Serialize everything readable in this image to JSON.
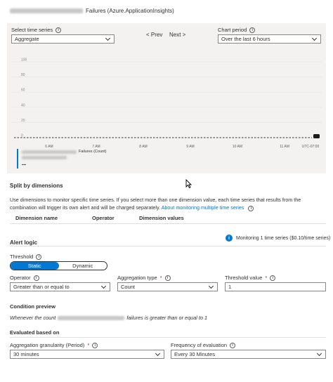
{
  "header": {
    "title_suffix": "Failures (Azure.ApplicationInsights)"
  },
  "timeseries": {
    "label": "Select time series",
    "value": "Aggregate",
    "prev_label": "< Prev",
    "next_label": "Next >"
  },
  "chart_period": {
    "label": "Chart period",
    "value": "Over the last 6 hours"
  },
  "chart_data": {
    "type": "line",
    "y_ticks": [
      "100",
      "80",
      "60",
      "40",
      "20",
      "0"
    ],
    "ylim": [
      0,
      100
    ],
    "x_ticks": [
      "6 AM",
      "7 AM",
      "8 AM",
      "9 AM",
      "10 AM",
      "11 AM",
      "UTC-07:00"
    ],
    "series": [
      {
        "name": "Failures (Count)",
        "values": [
          0,
          0,
          0,
          0,
          0,
          0
        ]
      }
    ],
    "grid": true,
    "legend": "bottom-left",
    "legend_value": "--"
  },
  "split": {
    "title": "Split by dimensions",
    "desc_line1": "Use dimensions to monitor specific time series. If you select more than one dimension value, each time series that results from the",
    "desc_line2": "combination will trigger its own alert and will be charged separately.",
    "link": "About monitoring multiple time series",
    "col_name": "Dimension name",
    "col_operator": "Operator",
    "col_values": "Dimension values"
  },
  "alert": {
    "title": "Alert logic",
    "monitoring_text": "Monitoring 1 time series ($0.10/time series)",
    "threshold_label": "Threshold",
    "static_label": "Static",
    "dynamic_label": "Dynamic",
    "operator_label": "Operator",
    "operator_value": "Greater than or equal to",
    "aggregation_label": "Aggregation type",
    "aggregation_value": "Count",
    "threshold_value_label": "Threshold value",
    "threshold_value": "1",
    "required_mark": "*"
  },
  "preview": {
    "title": "Condition preview",
    "text_before": "Whenever the count",
    "text_after": "failures is greater than or equal to 1"
  },
  "evaluated": {
    "title": "Evaluated based on",
    "granularity_label": "Aggregation granularity (Period)",
    "granularity_value": "30 minutes",
    "frequency_label": "Frequency of evaluation",
    "frequency_value": "Every 30 Minutes"
  },
  "icons": {
    "info": "info-icon",
    "chevron": "chevron-down-icon",
    "cursor": "mouse-cursor-icon"
  },
  "colors": {
    "accent": "#0078d4",
    "panel": "#f3f2f1",
    "required": "#a4262c"
  }
}
